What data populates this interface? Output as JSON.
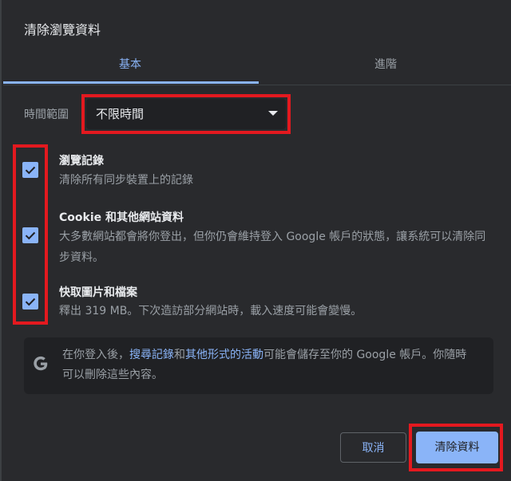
{
  "dialog": {
    "title": "清除瀏覽資料"
  },
  "tabs": [
    {
      "label": "基本",
      "active": true
    },
    {
      "label": "進階",
      "active": false
    }
  ],
  "time_range": {
    "label": "時間範圍",
    "selected": "不限時間"
  },
  "items": [
    {
      "title": "瀏覽記錄",
      "desc": "清除所有同步裝置上的記錄",
      "checked": true
    },
    {
      "title": "Cookie 和其他網站資料",
      "desc": "大多數網站都會將你登出，但你仍會維持登入 Google 帳戶的狀態，讓系統可以清除同步資料。",
      "checked": true
    },
    {
      "title": "快取圖片和檔案",
      "desc": "釋出 319 MB。下次造訪部分網站時，載入速度可能會變慢。",
      "checked": true
    }
  ],
  "info": {
    "prefix": "在你登入後，",
    "link1": "搜尋記錄",
    "middle": "和",
    "link2": "其他形式的活動",
    "suffix": "可能會儲存至你的 Google 帳戶。你隨時可以刪除這些內容。",
    "icon": "google-g-icon"
  },
  "buttons": {
    "cancel": "取消",
    "clear": "清除資料"
  },
  "colors": {
    "accent": "#8ab4f8",
    "background": "#292a2d",
    "highlight": "#e3191f"
  }
}
